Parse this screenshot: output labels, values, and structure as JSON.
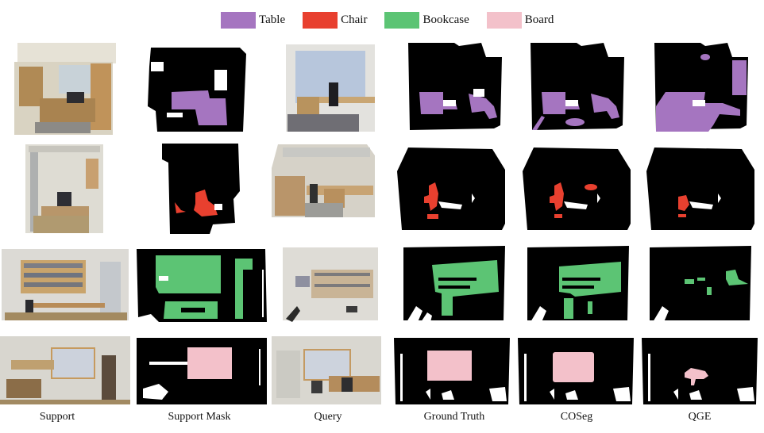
{
  "legend": {
    "items": [
      {
        "label": "Table",
        "color": "#A575C0"
      },
      {
        "label": "Chair",
        "color": "#E8402F"
      },
      {
        "label": "Bookcase",
        "color": "#5CC474"
      },
      {
        "label": "Board",
        "color": "#F3C1CA"
      }
    ]
  },
  "columns": [
    {
      "label": "Support"
    },
    {
      "label": "Support Mask"
    },
    {
      "label": "Query"
    },
    {
      "label": "Ground Truth"
    },
    {
      "label": "COSeg"
    },
    {
      "label": "QGE"
    }
  ],
  "rows": [
    {
      "class": "Table"
    },
    {
      "class": "Chair"
    },
    {
      "class": "Bookcase"
    },
    {
      "class": "Board"
    }
  ]
}
